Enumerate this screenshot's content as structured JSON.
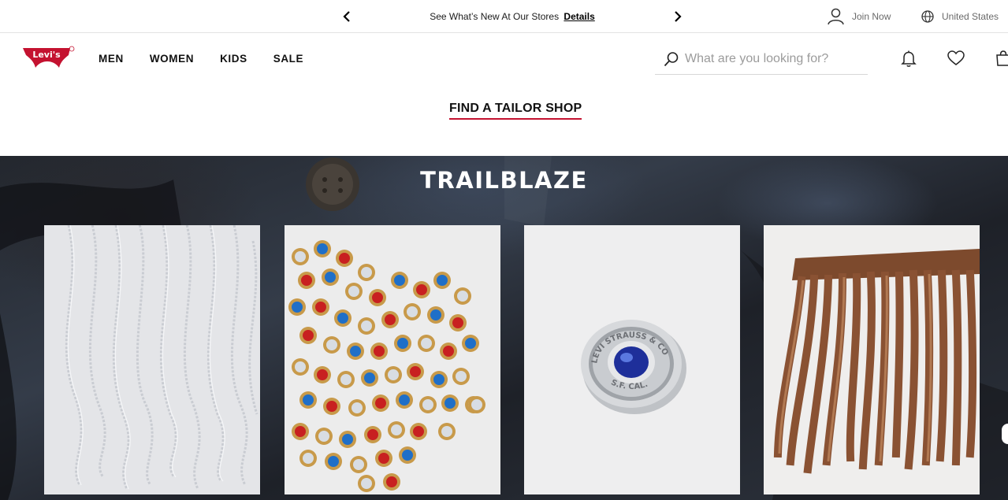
{
  "topbar": {
    "promo_text": "See What’s New At Our Stores",
    "promo_link": "Details",
    "join_label": "Join Now",
    "region_label": "United States"
  },
  "header": {
    "logo_text": "Levi's",
    "nav": [
      "MEN",
      "WOMEN",
      "KIDS",
      "SALE"
    ],
    "search_placeholder": "What are you looking for?"
  },
  "tailor": {
    "link_label": "FIND A TAILOR SHOP"
  },
  "hero": {
    "title": "TRAILBLAZE",
    "products": [
      {
        "subject": "silver chain fringe"
      },
      {
        "subject": "red and blue rhinestone studs"
      },
      {
        "subject": "Levi Strauss & Co SF Cal button"
      },
      {
        "subject": "brown leather fringe"
      }
    ]
  },
  "colors": {
    "accent": "#c41230",
    "brand_red": "#c41230",
    "text": "#111111",
    "muted": "#6a6a6a"
  }
}
